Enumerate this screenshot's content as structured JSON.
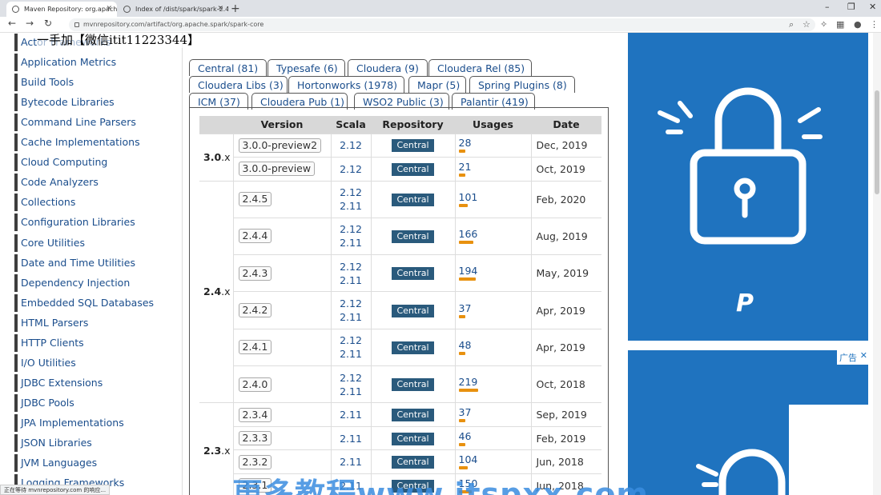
{
  "browser": {
    "tabs": [
      {
        "label": "Maven Repository: org.apache..."
      },
      {
        "label": "Index of /dist/spark/spark-2.4..."
      }
    ],
    "url": "mvnrepository.com/artifact/org.apache.spark/spark-core",
    "status": "正在等待 mvnrepository.com 的响应..."
  },
  "overlay_text": "一手加【微信itit11223344】",
  "watermark_text": "更多教程www.itspxx.com",
  "sidebar": {
    "items": [
      {
        "label": "Actor Frameworks"
      },
      {
        "label": "Application Metrics"
      },
      {
        "label": "Build Tools"
      },
      {
        "label": "Bytecode Libraries"
      },
      {
        "label": "Command Line Parsers"
      },
      {
        "label": "Cache Implementations"
      },
      {
        "label": "Cloud Computing"
      },
      {
        "label": "Code Analyzers"
      },
      {
        "label": "Collections"
      },
      {
        "label": "Configuration Libraries"
      },
      {
        "label": "Core Utilities"
      },
      {
        "label": "Date and Time Utilities"
      },
      {
        "label": "Dependency Injection"
      },
      {
        "label": "Embedded SQL Databases"
      },
      {
        "label": "HTML Parsers"
      },
      {
        "label": "HTTP Clients"
      },
      {
        "label": "I/O Utilities"
      },
      {
        "label": "JDBC Extensions"
      },
      {
        "label": "JDBC Pools"
      },
      {
        "label": "JPA Implementations"
      },
      {
        "label": "JSON Libraries"
      },
      {
        "label": "JVM Languages"
      },
      {
        "label": "Logging Frameworks"
      }
    ]
  },
  "repo_tabs": [
    {
      "label": "Central (81)"
    },
    {
      "label": "Typesafe (6)"
    },
    {
      "label": "Cloudera (9)"
    },
    {
      "label": "Cloudera Rel (85)"
    },
    {
      "label": "Cloudera Libs (3)"
    },
    {
      "label": "Hortonworks (1978)"
    },
    {
      "label": "Mapr (5)"
    },
    {
      "label": "Spring Plugins (8)"
    },
    {
      "label": "ICM (37)"
    },
    {
      "label": "Cloudera Pub (1)"
    },
    {
      "label": "WSO2 Public (3)"
    },
    {
      "label": "Palantir (419)"
    }
  ],
  "table": {
    "headers": {
      "version": "Version",
      "scala": "Scala",
      "repository": "Repository",
      "usages": "Usages",
      "date": "Date"
    },
    "groups": [
      {
        "major": "3.0",
        "suffix": ".x"
      },
      {
        "major": "2.4",
        "suffix": ".x"
      },
      {
        "major": "2.3",
        "suffix": ".x"
      }
    ],
    "rows": [
      {
        "version": "3.0.0-preview2",
        "scala": [
          "2.12"
        ],
        "repo": "Central",
        "usages": "28",
        "usage_level": 0.13,
        "date": "Dec, 2019"
      },
      {
        "version": "3.0.0-preview",
        "scala": [
          "2.12"
        ],
        "repo": "Central",
        "usages": "21",
        "usage_level": 0.1,
        "date": "Oct, 2019"
      },
      {
        "version": "2.4.5",
        "scala": [
          "2.12",
          "2.11"
        ],
        "repo": "Central",
        "usages": "101",
        "usage_level": 0.46,
        "date": "Feb, 2020"
      },
      {
        "version": "2.4.4",
        "scala": [
          "2.12",
          "2.11"
        ],
        "repo": "Central",
        "usages": "166",
        "usage_level": 0.76,
        "date": "Aug, 2019"
      },
      {
        "version": "2.4.3",
        "scala": [
          "2.12",
          "2.11"
        ],
        "repo": "Central",
        "usages": "194",
        "usage_level": 0.89,
        "date": "May, 2019"
      },
      {
        "version": "2.4.2",
        "scala": [
          "2.12",
          "2.11"
        ],
        "repo": "Central",
        "usages": "37",
        "usage_level": 0.17,
        "date": "Apr, 2019"
      },
      {
        "version": "2.4.1",
        "scala": [
          "2.12",
          "2.11"
        ],
        "repo": "Central",
        "usages": "48",
        "usage_level": 0.22,
        "date": "Apr, 2019"
      },
      {
        "version": "2.4.0",
        "scala": [
          "2.12",
          "2.11"
        ],
        "repo": "Central",
        "usages": "219",
        "usage_level": 1.0,
        "date": "Oct, 2018"
      },
      {
        "version": "2.3.4",
        "scala": [
          "2.11"
        ],
        "repo": "Central",
        "usages": "37",
        "usage_level": 0.17,
        "date": "Sep, 2019"
      },
      {
        "version": "2.3.3",
        "scala": [
          "2.11"
        ],
        "repo": "Central",
        "usages": "46",
        "usage_level": 0.21,
        "date": "Feb, 2019"
      },
      {
        "version": "2.3.2",
        "scala": [
          "2.11"
        ],
        "repo": "Central",
        "usages": "104",
        "usage_level": 0.47,
        "date": "Jun, 2018"
      },
      {
        "version": "2.3.1",
        "scala": [
          "2.11"
        ],
        "repo": "Central",
        "usages": "150",
        "usage_level": 0.68,
        "date": "Jun, 2018"
      }
    ]
  },
  "ads": {
    "label": "广告",
    "close": "✕"
  },
  "colors": {
    "accent_blue": "#1f73bf",
    "usage_bar": "#e8910f",
    "central_badge": "#2a5a7c",
    "sidebar_text": "#1a4d8c"
  }
}
